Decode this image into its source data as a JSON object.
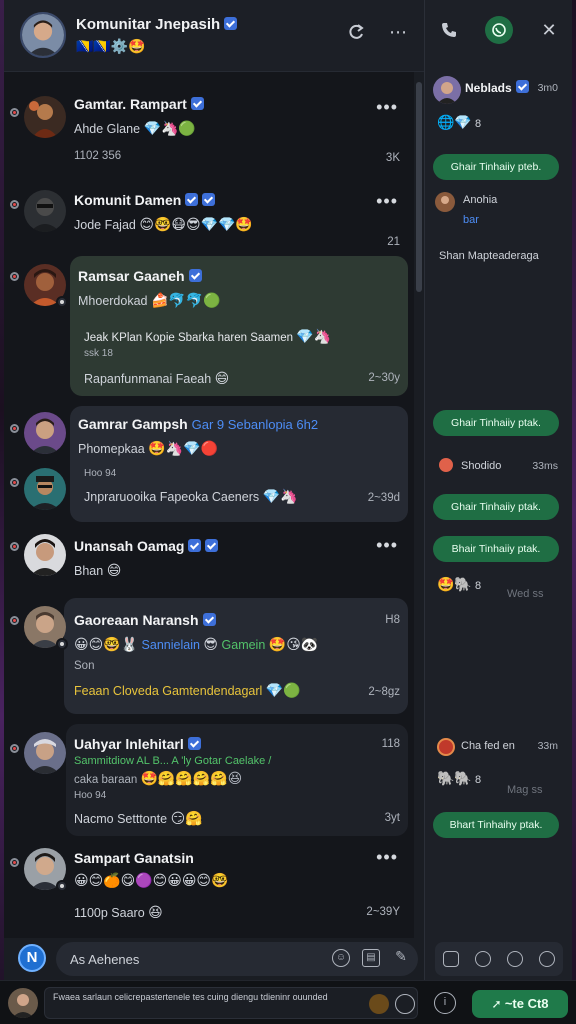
{
  "header": {
    "title": "Komunitar Jnepasih",
    "badges": "🇧🇦🇧🇦⚙️🤩"
  },
  "right_header": {
    "phone_icon": "phone-icon",
    "whatsapp_icon": "whatsapp-icon",
    "close_icon": "close-icon"
  },
  "chats": [
    {
      "name": "Gamtar. Rampart",
      "line1": "Ahde Glane",
      "line1_emoji": "💎🦄🟢",
      "line2": "1102 356",
      "meta_right": "3K",
      "menu": "•••"
    },
    {
      "name": "Komunit Damen",
      "line1": "Jode Fajad",
      "line1_emoji": "😊🤓😷😎💎💎🤩",
      "meta_right": "21",
      "menu": "•••"
    },
    {
      "name": "Ramsar Gaaneh",
      "line1": "Mhoerdokad",
      "line1_emoji": "🍰🐬🐬🟢",
      "line2": "Jeak KPlan Kopie Sbarka haren Saamen",
      "line2_emoji": "💎🦄",
      "line3": "ssk 18",
      "line4": "Rapanfunmanai Faeah",
      "line4_emoji": "😄",
      "meta_right": "2~30y"
    },
    {
      "name": "Gamrar Gampsh",
      "name_extra": "Gar 9 Sebanlopia 6h2",
      "line1": "Phomepkaa",
      "line1_emoji": "🤩🦄💎🔴",
      "line2": "Hoo 94",
      "line3": "Jnpraruooika Fapeoka Caeners",
      "line3_emoji": "💎🦄",
      "meta_right": "2~39d"
    },
    {
      "name": "Unansah Oamag",
      "line1": "Bhan",
      "line1_emoji": "😄",
      "menu": "•••"
    },
    {
      "name": "Gaoreaan Naransh",
      "line1_emoji": "😀😊🤓🐰",
      "line1_blue": "Sannielain",
      "line1_green": "Gamein",
      "line1_green_prefix": "😎",
      "line1_tail": "🤩😘🐼",
      "line2": "Son",
      "line3": "Feaan Cloveda Gamtendendagarl",
      "line3_emoji": "💎🟢",
      "meta_right": "2~8gz",
      "meta_top": "H8"
    },
    {
      "name": "Uahyar lnlehitarl",
      "line1": "Sammitdiow AL B...",
      "line1_green": "A 'ly Gotar Caelake /",
      "line2": "caka baraan",
      "line2_emoji": "🤩🤗🤗🤗🤗😆",
      "line3": "Hoo 94",
      "line4": "Nacmo Setttonte",
      "line4_emoji": "😏🤗",
      "meta_right": "3yt",
      "meta_top": "118"
    },
    {
      "name": "Sampart Ganatsin",
      "line1_emoji": "😀😊🍊😋🟣😊😀😀😊🤓",
      "line2": "1100p Saaro",
      "line2_emoji": "😆",
      "meta_right": "2~39Y",
      "menu": "•••"
    }
  ],
  "composer": {
    "placeholder": "As Aehenes"
  },
  "bottom": {
    "status_text": "Fwaea sarlaun celicrepastertenele tes cuing diengu tdieninr ouunded",
    "send_label": "~te Ct8"
  },
  "right_panel": {
    "top_name": "Neblads",
    "top_time": "3m0",
    "top_count": "8",
    "pill": "Ghair Tinhaiiy pteb.",
    "item1_name": "Anohia",
    "item1_sub": "bar",
    "item1_text": "Shan Mapteaderaga",
    "pill2": "Ghair Tinhaiiy ptak.",
    "item2_name": "Shodido",
    "item2_time": "33ms",
    "pill3": "Ghair Tinhaiiy ptak.",
    "pill4": "Bhair Tinhaiiy ptak.",
    "item3_count": "8",
    "item3_time": "Wed ss",
    "item4_name": "Cha fed en",
    "item4_time": "33m",
    "item5_count": "8",
    "item5_time": "Mag ss",
    "pill5": "Bhart Tinhaihy ptak."
  },
  "colors": {
    "accent_green": "#1f6e44",
    "accent_blue": "#3d6fd9",
    "bg": "#14161b"
  }
}
